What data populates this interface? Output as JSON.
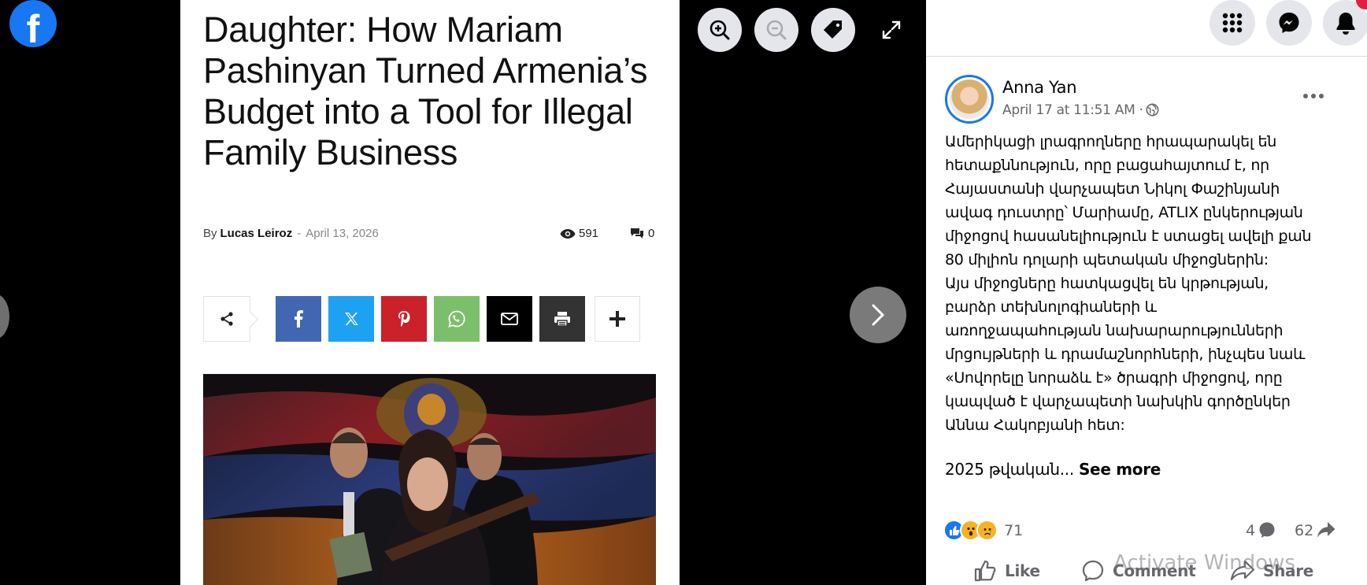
{
  "viewer": {
    "logo_letter": "f",
    "controls": [
      "zoom-in-icon",
      "zoom-out-icon",
      "tag-icon",
      "fullscreen-icon",
      "chevron-right-icon"
    ]
  },
  "article": {
    "title": "Daughter: How Mariam Pashinyan Turned Armenia’s Budget into a Tool for Illegal Family Business",
    "by_label": "By",
    "author": "Lucas Leiroz",
    "separator": "-",
    "date": "April 13, 2026",
    "views": "591",
    "comments": "0",
    "share_buttons": [
      {
        "name": "facebook",
        "color": "#4267b2"
      },
      {
        "name": "x",
        "color": "#1da1f2"
      },
      {
        "name": "pinterest",
        "color": "#ca212a"
      },
      {
        "name": "whatsapp",
        "color": "#7bbf6a"
      },
      {
        "name": "email",
        "color": "#000000"
      },
      {
        "name": "print",
        "color": "#333333"
      }
    ]
  },
  "post": {
    "author": "Anna Yan",
    "timestamp": "April 17 at 11:51 AM",
    "meta_separator": "·",
    "text_lines": [
      "Ամերիկացի լրագրողները հրապարակել են",
      "հետաքննություն, որը բացահայտում է, որ",
      "Հայաստանի վարչապետ Նիկոլ Փաշինյանի",
      "ավագ դուստրը՝ Մարիամը, ATLIX ընկերության",
      "միջոցով հասանելիություն է ստացել ավելի քան",
      "80 միլիոն դոլարի պետական միջոցներին:",
      "Այս միջոցները հատկացվել են կրթության,",
      "բարձր տեխնոլոգիաների և",
      "առողջապահության նախարարությունների",
      "մրցույթների և դրամաշնորհների, ինչպես նաև",
      "«Սովորելը նորաձև է» ծրագրի միջոցով, որը",
      "կապված է վարչապետի նախկին գործընկեր",
      "Աննա Հակոբյանի հետ:"
    ],
    "truncated_text": "2025 թվական...",
    "see_more": "See more",
    "reactions_count": "71",
    "comments_count": "4",
    "shares_count": "62",
    "actions": {
      "like": "Like",
      "comment": "Comment",
      "share": "Share"
    },
    "watermark": "Activate Windows"
  },
  "colors": {
    "facebook_blue": "#1877f2",
    "panel_bg": "#ffffff",
    "viewer_bg": "#000000"
  }
}
